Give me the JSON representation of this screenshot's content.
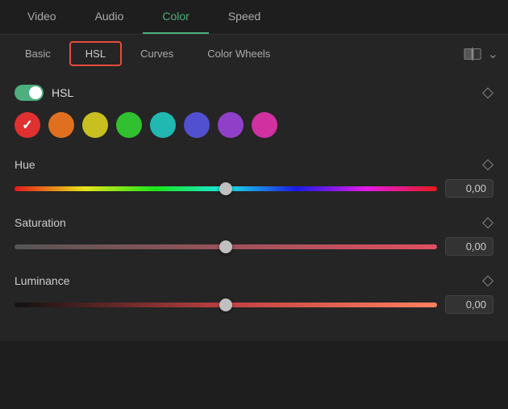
{
  "topTabs": [
    {
      "label": "Video",
      "active": false
    },
    {
      "label": "Audio",
      "active": false
    },
    {
      "label": "Color",
      "active": true
    },
    {
      "label": "Speed",
      "active": false
    }
  ],
  "subTabs": [
    {
      "label": "Basic",
      "active": false
    },
    {
      "label": "HSL",
      "active": true
    },
    {
      "label": "Curves",
      "active": false
    },
    {
      "label": "Color Wheels",
      "active": false
    }
  ],
  "hslSection": {
    "toggleLabel": "HSL",
    "hueLabel": "Hue",
    "hueValue": "0,00",
    "hueThumbPercent": 50,
    "saturationLabel": "Saturation",
    "saturationValue": "0,00",
    "satThumbPercent": 50,
    "luminanceLabel": "Luminance",
    "luminanceValue": "0,00",
    "lumThumbPercent": 50
  },
  "colorCircles": [
    {
      "color": "#e03030",
      "selected": true,
      "name": "red"
    },
    {
      "color": "#e07020",
      "selected": false,
      "name": "orange"
    },
    {
      "color": "#c8c020",
      "selected": false,
      "name": "yellow"
    },
    {
      "color": "#30c030",
      "selected": false,
      "name": "green"
    },
    {
      "color": "#20b8b0",
      "selected": false,
      "name": "cyan"
    },
    {
      "color": "#5050d0",
      "selected": false,
      "name": "blue"
    },
    {
      "color": "#9040c8",
      "selected": false,
      "name": "purple"
    },
    {
      "color": "#d030a0",
      "selected": false,
      "name": "magenta"
    }
  ]
}
